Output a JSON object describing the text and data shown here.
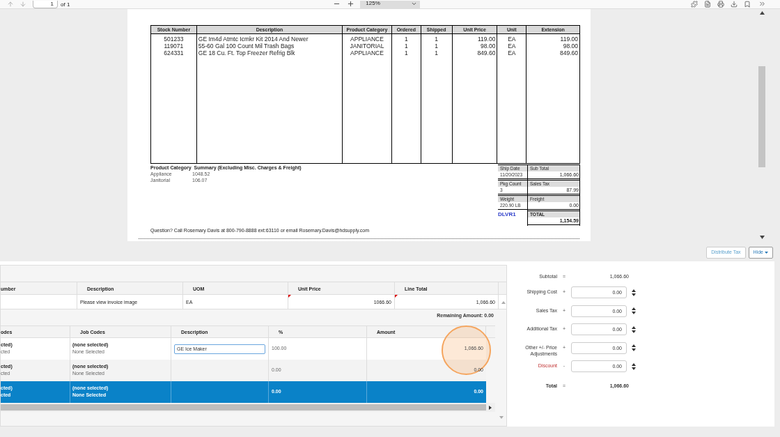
{
  "toolbar": {
    "page": "1",
    "page_count": "of 1",
    "zoom": "125%"
  },
  "invoice": {
    "columns": [
      "Stock Number",
      "Description",
      "Product Category",
      "Ordered",
      "Shipped",
      "Unit Price",
      "Unit",
      "Extension"
    ],
    "rows": [
      [
        "501233",
        "GE Im4d Atmtc Icmkr Kit 2014 And Newer",
        "APPLIANCE",
        "1",
        "1",
        "119.00",
        "EA",
        "119.00"
      ],
      [
        "119071",
        "55-60 Gal 100 Count Mil Trash Bags",
        "JANITORIAL",
        "1",
        "1",
        "98.00",
        "EA",
        "98.00"
      ],
      [
        "624331",
        "GE 18 Cu. Ft. Top Freezer Refrig Blk",
        "APPLIANCE",
        "1",
        "1",
        "849.60",
        "EA",
        "849.60"
      ]
    ],
    "summary_title": "Product Category  Summary (Excluding Misc. Charges & Freight)",
    "summary": [
      {
        "label": "Appliance",
        "value": "1048.52"
      },
      {
        "label": "Janitorial",
        "value": "106.07"
      }
    ],
    "ship_info": [
      {
        "label": "Ship Date",
        "value": "11/20/2023"
      },
      {
        "label": "Pkg Count",
        "value": "3"
      },
      {
        "label": "Weight",
        "value": "220.90 LB"
      }
    ],
    "totals": [
      {
        "label": "Sub Total",
        "value": "1,066.60"
      },
      {
        "label": "Sales Tax",
        "value": "87.99"
      },
      {
        "label": "Freight",
        "value": "0.00"
      },
      {
        "label": "TOTAL",
        "value": "1,154.59"
      }
    ],
    "route": "DLVR1",
    "footer": "Question? Call Rosemary Davis at 800-790-8888 ext:63110 or email Rosemary.Davis@hdsupply.com"
  },
  "actions": [
    {
      "label": "Distribute Tax",
      "kind": "button"
    },
    {
      "label": "Hide",
      "kind": "dropdown"
    }
  ],
  "line_items": {
    "columns": [
      "umber",
      "Description",
      "UOM",
      "Unit Price",
      "Line Total"
    ],
    "rows": [
      {
        "cells": [
          "",
          "Please view invoice image",
          "EA",
          "1066.60",
          "1,066.60"
        ],
        "modified": [
          false,
          false,
          false,
          true,
          true
        ]
      }
    ],
    "remaining": "Remaining Amount: 0.00"
  },
  "allocations": {
    "columns": [
      "odes",
      "Job Codes",
      "Description",
      "%",
      "Amount"
    ],
    "rows": [
      {
        "selected": false,
        "code": [
          "cted)",
          "cted"
        ],
        "job": [
          "(none selected)",
          "None Selected"
        ],
        "description": "GE Ice Maker",
        "percent": "100.00",
        "amount": "1,066.60"
      },
      {
        "selected": false,
        "code": [
          "cted)",
          "cted"
        ],
        "job": [
          "(none selected)",
          "None Selected"
        ],
        "percent": "0.00",
        "amount": "0.00"
      },
      {
        "selected": true,
        "code": [
          "cted)",
          "cted"
        ],
        "job": [
          "(none selected)",
          "None Selected"
        ],
        "percent": "0.00",
        "amount": "0.00"
      }
    ]
  },
  "totals": [
    {
      "label": "Subtotal",
      "sign": "=",
      "value": "1,066.60",
      "kind": "sum"
    },
    {
      "label": "Shipping Cost",
      "sign": "+",
      "value": "0.00",
      "kind": "input"
    },
    {
      "label": "Sales Tax",
      "sign": "+",
      "value": "0.00",
      "kind": "input"
    },
    {
      "label": "Additional Tax",
      "sign": "+",
      "value": "0.00",
      "kind": "input"
    },
    {
      "label": "Other +/- Price Adjustments",
      "sign": "+",
      "value": "0.00",
      "kind": "input"
    },
    {
      "label": "Discount",
      "sign": "-",
      "value": "0.00",
      "kind": "deduction"
    },
    {
      "label": "Total",
      "sign": "=",
      "value": "1,066.60",
      "kind": "total"
    }
  ]
}
